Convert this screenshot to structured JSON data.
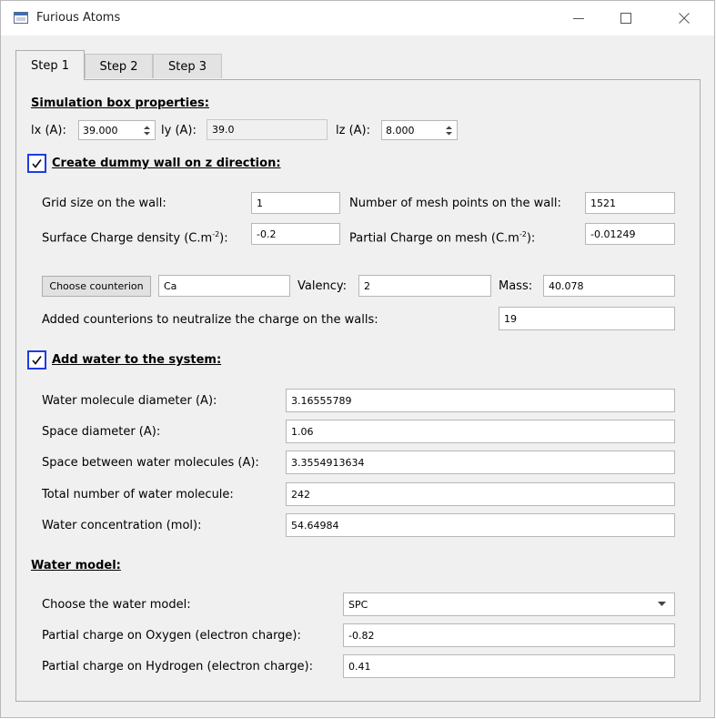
{
  "window": {
    "title": "Furious Atoms"
  },
  "tabs": [
    {
      "label": "Step 1"
    },
    {
      "label": "Step 2"
    },
    {
      "label": "Step 3"
    }
  ],
  "box": {
    "heading": "Simulation box  properties:",
    "lx_label": "lx (A):",
    "lx_value": "39.000",
    "ly_label": "ly (A):",
    "ly_value": "39.0",
    "lz_label": "lz (A):",
    "lz_value": "8.000"
  },
  "wall": {
    "checkbox_label": "Create dummy wall on z direction:",
    "checked": true,
    "grid_size_label": "Grid size on the wall:",
    "grid_size_value": "1",
    "mesh_points_label": "Number of mesh points on the wall:",
    "mesh_points_value": "1521",
    "surface_charge_label_pre": "Surface Charge density (C.m",
    "surface_charge_label_sup": "-2",
    "surface_charge_label_post": "):",
    "surface_charge_value": "-0.2",
    "partial_charge_label_pre": "Partial Charge on mesh (C.m",
    "partial_charge_label_sup": "-2",
    "partial_charge_label_post": "):",
    "partial_charge_value": "-0.01249",
    "choose_counterion_label": "Choose counterion",
    "counterion_value": "Ca",
    "valency_label": "Valency:",
    "valency_value": "2",
    "mass_label": "Mass:",
    "mass_value": "40.078",
    "added_counterions_label": "Added counterions to neutralize the charge on the walls:",
    "added_counterions_value": "19"
  },
  "water": {
    "checkbox_label": "Add water to the system:",
    "checked": true,
    "diameter_label": "Water molecule diameter (A):",
    "diameter_value": "3.16555789",
    "space_diameter_label": "Space diameter (A):",
    "space_diameter_value": "1.06",
    "space_between_label": "Space between water molecules (A):",
    "space_between_value": "3.3554913634",
    "total_label": "Total number of water molecule:",
    "total_value": "242",
    "concentration_label": "Water concentration (mol):",
    "concentration_value": "54.64984"
  },
  "model": {
    "heading": "Water model:",
    "choose_label": "Choose the water model:",
    "choose_value": "SPC",
    "oxygen_label": "Partial charge on Oxygen (electron charge):",
    "oxygen_value": "-0.82",
    "hydrogen_label": "Partial charge on Hydrogen (electron charge):",
    "hydrogen_value": "0.41"
  },
  "colors": {
    "checkbox_border": "#1e3ce1",
    "window_bg": "#f0f0f0"
  }
}
